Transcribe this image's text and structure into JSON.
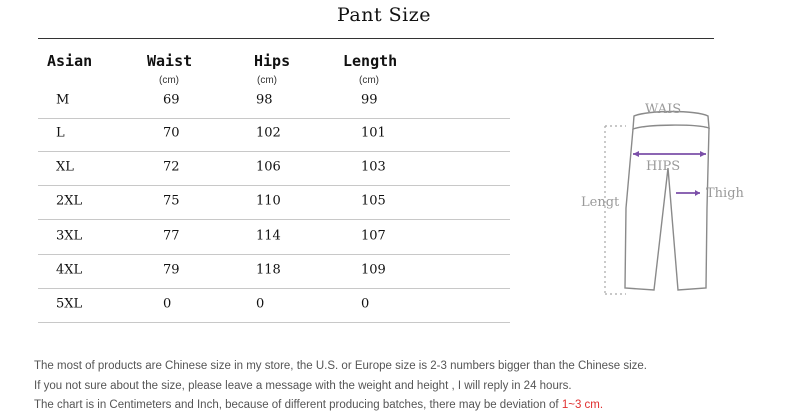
{
  "title": "Pant Size",
  "table": {
    "headers": {
      "size": "Asian",
      "waist": "Waist",
      "hips": "Hips",
      "length": "Length"
    },
    "units": {
      "waist": "(cm)",
      "hips": "(cm)",
      "length": "(cm)"
    },
    "rows": [
      {
        "size": "M",
        "waist": "69",
        "hips": "98",
        "length": "99"
      },
      {
        "size": "L",
        "waist": "70",
        "hips": "102",
        "length": "101"
      },
      {
        "size": "XL",
        "waist": "72",
        "hips": "106",
        "length": "103"
      },
      {
        "size": "2XL",
        "waist": "75",
        "hips": "110",
        "length": "105"
      },
      {
        "size": "3XL",
        "waist": "77",
        "hips": "114",
        "length": "107"
      },
      {
        "size": "4XL",
        "waist": "79",
        "hips": "118",
        "length": "109"
      },
      {
        "size": "5XL",
        "waist": "0",
        "hips": "0",
        "length": "0"
      }
    ]
  },
  "diagram": {
    "waist_label": "WAIS",
    "hips_label": "HIPS",
    "length_label": "Lengt",
    "thigh_label": "Thigh"
  },
  "notes": {
    "line1": "The most of products are Chinese size in my store, the U.S. or Europe size is 2-3 numbers bigger than the Chinese size.",
    "line2": "If you not sure about the size, please leave a message with the weight and height , I will reply in 24 hours.",
    "line3_prefix": "The chart is in Centimeters and Inch, because of different producing batches, there may be deviation of ",
    "line3_highlight": "1~3 cm."
  },
  "colors": {
    "highlight": "#e03030",
    "measure_line": "#7b4fa8"
  }
}
